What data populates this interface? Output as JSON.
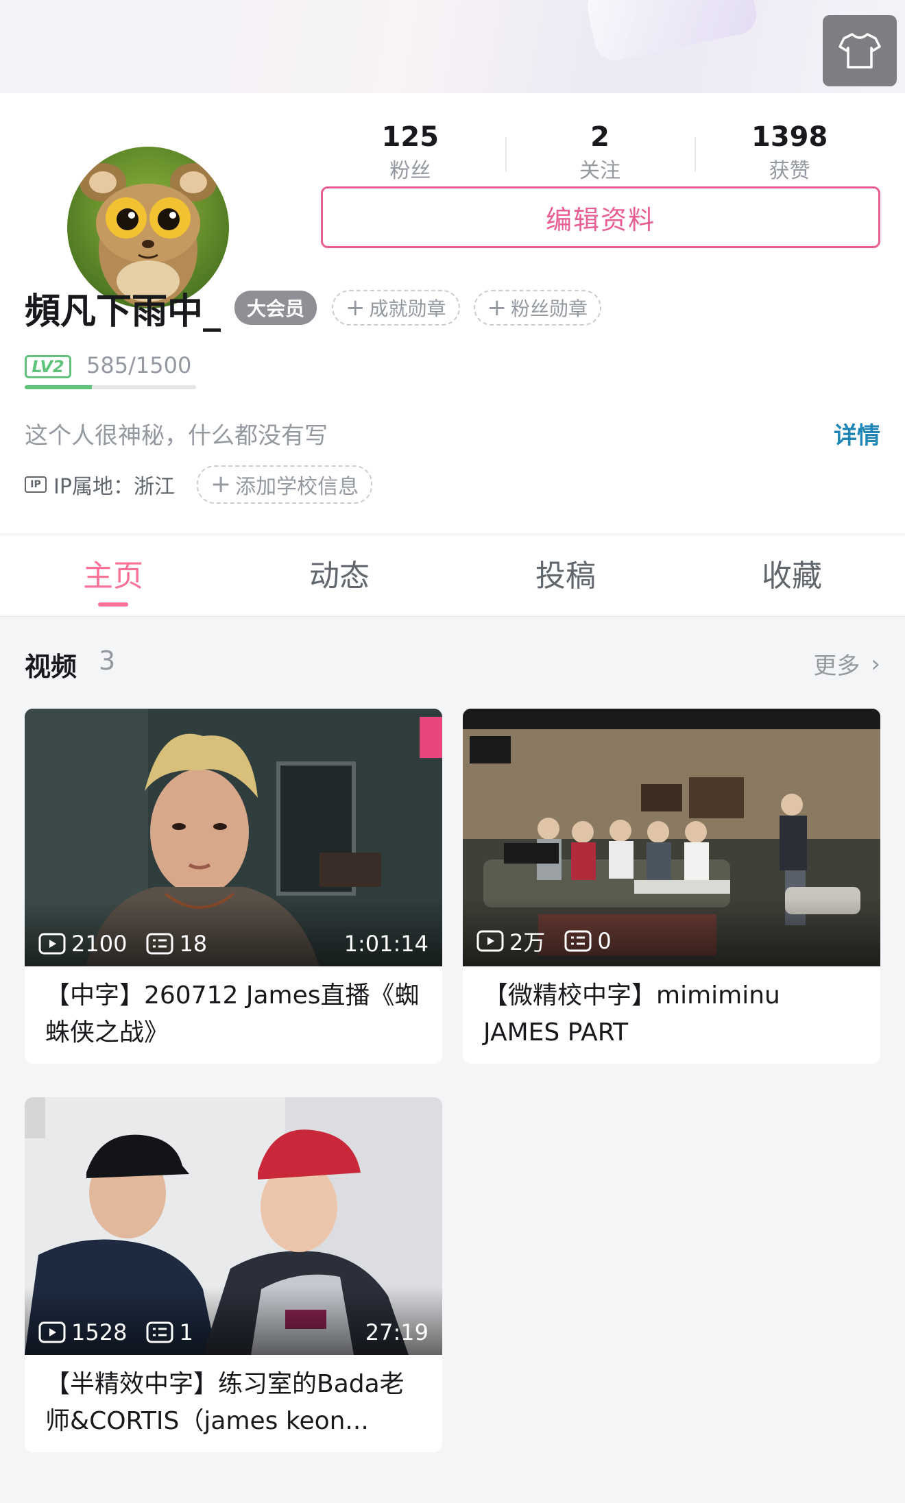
{
  "header": {
    "skin_icon": "t-shirt-icon"
  },
  "stats": [
    {
      "value": "125",
      "label": "粉丝"
    },
    {
      "value": "2",
      "label": "关注"
    },
    {
      "value": "1398",
      "label": "获赞"
    }
  ],
  "edit_label": "编辑资料",
  "user": {
    "name": "頻凡下雨中_",
    "vip": "大会员",
    "badges": [
      "成就勋章",
      "粉丝勋章"
    ],
    "level": "LV2",
    "exp": "585/1500",
    "exp_fraction": 0.39,
    "bio": "这个人很神秘，什么都没有写",
    "detail_label": "详情",
    "ip_icon": "IP",
    "ip": "IP属地：浙江",
    "school": "添加学校信息"
  },
  "tabs": [
    "主页",
    "动态",
    "投稿",
    "收藏"
  ],
  "videos_section": {
    "title": "视频",
    "count": "3",
    "more": "更多"
  },
  "videos": [
    {
      "plays": "2100",
      "comments": "18",
      "duration": "1:01:14",
      "title": "【中字】260712 James直播《蜘蛛侠之战》"
    },
    {
      "plays": "2万",
      "comments": "0",
      "duration": "",
      "title": "【微精校中字】mimiminu JAMES PART"
    },
    {
      "plays": "1528",
      "comments": "1",
      "duration": "27:19",
      "title": "【半精效中字】练习室的Bada老师&CORTIS（james keon..."
    }
  ],
  "colors": {
    "accent": "#fb7299",
    "edit_border": "#e85d92",
    "level": "#5fc37c",
    "link": "#1f86b5"
  }
}
